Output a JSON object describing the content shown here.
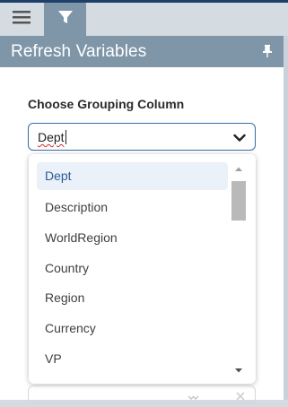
{
  "tabs": [
    {
      "name": "menu",
      "icon": "hamburger-icon",
      "active": false
    },
    {
      "name": "filter",
      "icon": "filter-icon",
      "active": true
    }
  ],
  "panel": {
    "title": "Refresh Variables",
    "pin_icon": "pin-icon"
  },
  "grouping": {
    "label": "Choose Grouping Column",
    "input_value": "Dept"
  },
  "dropdown": {
    "options": [
      {
        "label": "Dept",
        "selected": true
      },
      {
        "label": "Description",
        "selected": false
      },
      {
        "label": "WorldRegion",
        "selected": false
      },
      {
        "label": "Country",
        "selected": false
      },
      {
        "label": "Region",
        "selected": false
      },
      {
        "label": "Currency",
        "selected": false
      },
      {
        "label": "VP",
        "selected": false
      }
    ]
  },
  "colors": {
    "header": "#7f95a8",
    "accent": "#3a6aa6",
    "selected_bg": "#eaf1f9",
    "top_strip": "#1f3f6b"
  }
}
